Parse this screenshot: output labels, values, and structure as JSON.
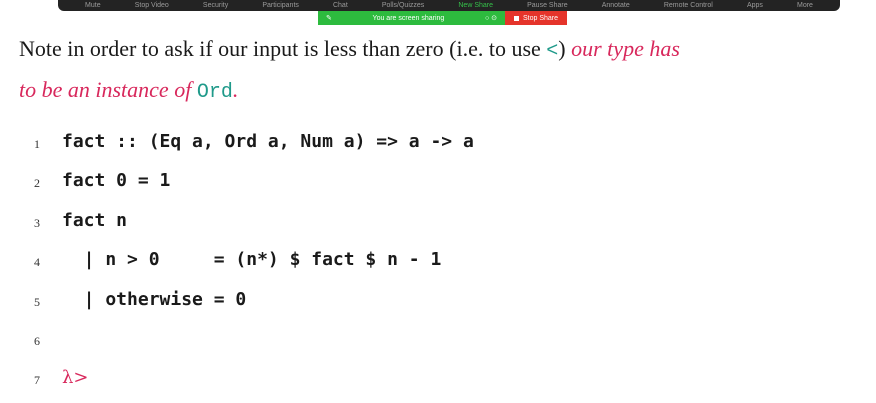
{
  "zoom_toolbar": {
    "items": [
      "Mute",
      "Stop Video",
      "Security",
      "Participants",
      "Chat",
      "Polls/Quizzes",
      "New Share",
      "Pause Share",
      "Annotate",
      "Remote Control",
      "Apps",
      "More"
    ]
  },
  "share_banner": {
    "message": "You are screen sharing",
    "stop_label": "Stop Share"
  },
  "prose": {
    "part1": "Note in order to ask if our input is less than zero (i.e. to use ",
    "op": "<",
    "part2": ") ",
    "emph1": "our type has",
    "emph2": "to be an instance of ",
    "cls": "Ord",
    "period": "."
  },
  "code": {
    "lines": [
      {
        "n": "1",
        "text": "fact :: (Eq a, Ord a, Num a) => a -> a"
      },
      {
        "n": "2",
        "text": "fact 0 = 1"
      },
      {
        "n": "3",
        "text": "fact n"
      },
      {
        "n": "4",
        "text": "  | n > 0     = (n*) $ fact $ n - 1"
      },
      {
        "n": "5",
        "text": "  | otherwise = 0"
      },
      {
        "n": "6",
        "text": ""
      },
      {
        "n": "7",
        "text": ""
      }
    ],
    "prompt": "λ>"
  }
}
